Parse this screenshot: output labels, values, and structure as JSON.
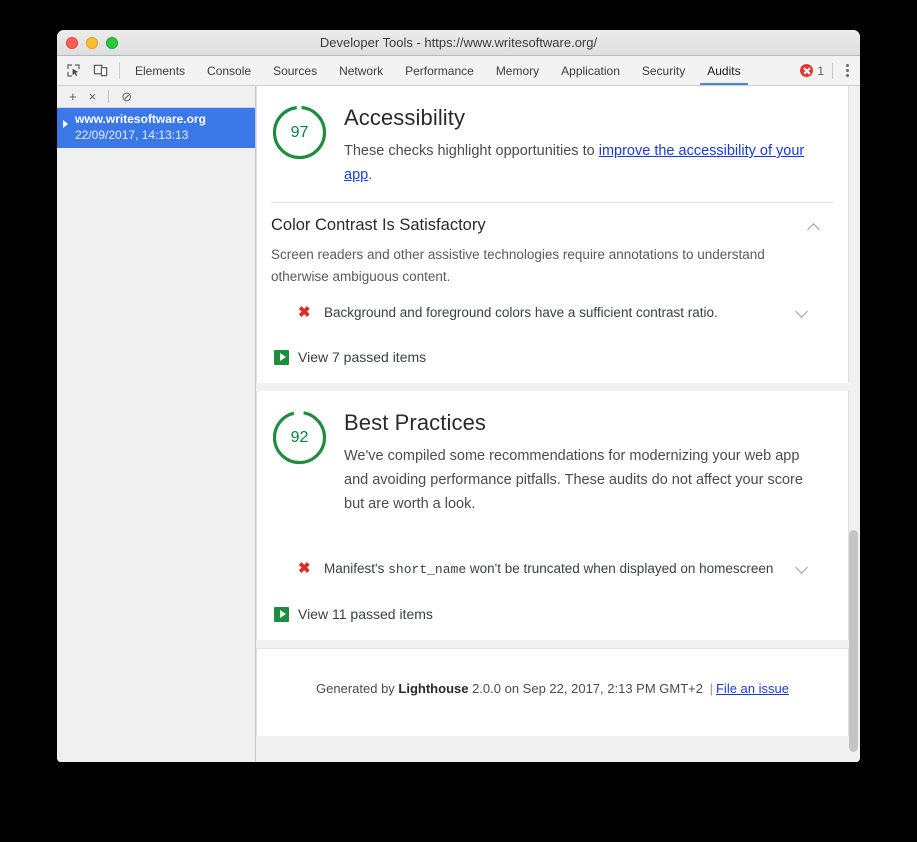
{
  "window": {
    "title": "Developer Tools - https://www.writesoftware.org/",
    "traffic_lights": [
      "close",
      "minimize",
      "maximize"
    ]
  },
  "devtools": {
    "left_icons": [
      "inspect-element-icon",
      "device-toolbar-icon"
    ],
    "tabs": [
      {
        "label": "Elements",
        "active": false
      },
      {
        "label": "Console",
        "active": false
      },
      {
        "label": "Sources",
        "active": false
      },
      {
        "label": "Network",
        "active": false
      },
      {
        "label": "Performance",
        "active": false
      },
      {
        "label": "Memory",
        "active": false
      },
      {
        "label": "Application",
        "active": false
      },
      {
        "label": "Security",
        "active": false
      },
      {
        "label": "Audits",
        "active": true
      }
    ],
    "error_count": "1",
    "accent_blue": "#4285f4",
    "error_red": "#e03a32"
  },
  "sidebar": {
    "toolbar": {
      "add": "+",
      "delete": "×",
      "clear": "⊘"
    },
    "report": {
      "url": "www.writesoftware.org",
      "date": "22/09/2017, 14:13:13",
      "selected_color": "#3b78e7"
    }
  },
  "report": {
    "categories": [
      {
        "score": "97",
        "title": "Accessibility",
        "desc_before": "These checks highlight opportunities to ",
        "desc_link": "improve the accessibility of your app",
        "desc_after": ".",
        "group": {
          "title": "Color Contrast Is Satisfactory",
          "description": "Screen readers and other assistive technologies require annotations to understand otherwise ambiguous content.",
          "toggle_icon": "chevron-up-icon"
        },
        "audits": [
          {
            "status": "fail",
            "icon": "x-mark-icon",
            "text_before": "Background and foreground colors have a sufficient contrast ratio.",
            "code": "",
            "text_after": "",
            "toggle_icon": "chevron-down-icon"
          }
        ],
        "passed_label": "View 7 passed items"
      },
      {
        "score": "92",
        "title": "Best Practices",
        "desc_before": "We've compiled some recommendations for modernizing your web app and avoiding performance pitfalls. These audits do not affect your score but are worth a look.",
        "desc_link": "",
        "desc_after": "",
        "group": null,
        "audits": [
          {
            "status": "fail",
            "icon": "x-mark-icon",
            "text_before": "Manifest's ",
            "code": "short_name",
            "text_after": " won't be truncated when displayed on homescreen",
            "toggle_icon": "chevron-down-icon"
          }
        ],
        "passed_label": "View 11 passed items"
      }
    ],
    "footer": {
      "prefix": "Generated by ",
      "brand": "Lighthouse",
      "version_and_date": " 2.0.0 on Sep 22, 2017, 2:13 PM GMT+2 ",
      "pipe": "|",
      "link": "File an issue"
    },
    "score_green": "#0b8043"
  }
}
